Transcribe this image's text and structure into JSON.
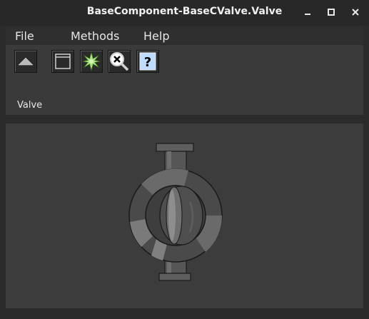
{
  "window": {
    "title": "BaseComponent-BaseCValve.Valve",
    "controls": {
      "minimize": "minimize-icon",
      "maximize": "maximize-icon",
      "close": "close-icon"
    }
  },
  "menu": {
    "file": "File",
    "methods": "Methods",
    "help": "Help"
  },
  "toolbar": {
    "buttons": [
      {
        "icon": "up-arrow-icon"
      },
      {
        "icon": "window-icon"
      },
      {
        "icon": "sparkle-icon"
      },
      {
        "icon": "magnify-x-icon"
      },
      {
        "icon": "help-question-icon"
      }
    ],
    "help_glyph": "?"
  },
  "panel": {
    "label": "Valve"
  },
  "graphic": {
    "icon": "valve-icon",
    "colors": {
      "body": "#5a5a5a",
      "ring_light": "#6e6e6e",
      "ring_dark": "#3e3e3e",
      "outline": "#1a1a1a",
      "highlight": "#8a8a8a"
    }
  }
}
